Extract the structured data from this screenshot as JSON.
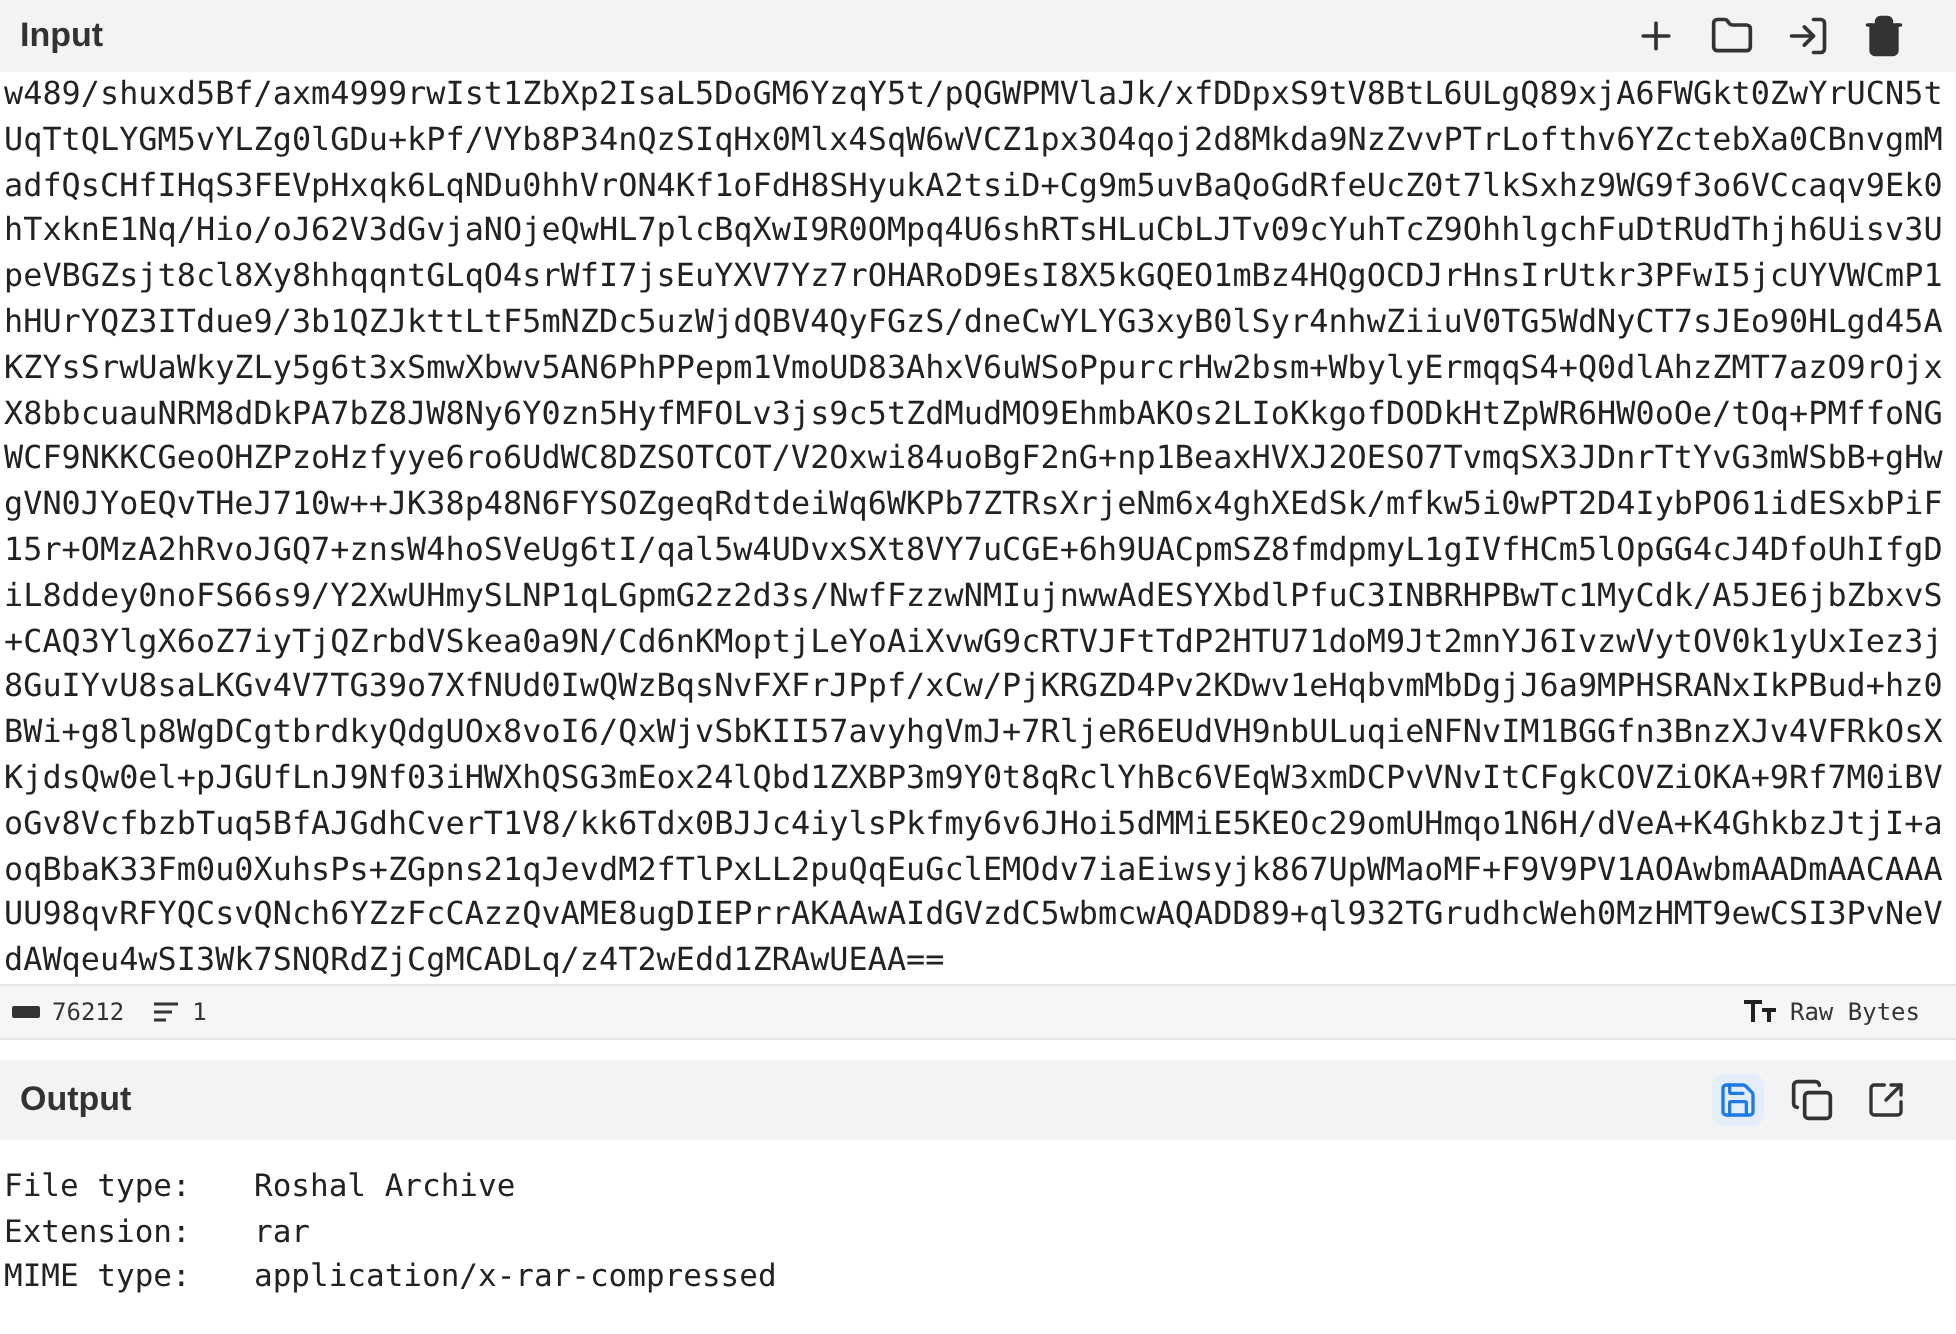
{
  "input": {
    "title": "Input",
    "lines": [
      "w489/shuxd5Bf/axm4999rwIst1ZbXp2IsaL5DoGM6YzqY5t/pQGWPMVlaJk/xfDDpxS9tV8BtL6ULgQ89xjA6FWGkt0ZwYrUCN5t",
      "UqTtQLYGM5vYLZg0lGDu+kPf/VYb8P34nQzSIqHx0Mlx4SqW6wVCZ1px3O4qoj2d8Mkda9NzZvvPTrLofthv6YZctebXa0CBnvgmM",
      "adfQsCHfIHqS3FEVpHxqk6LqNDu0hhVrON4Kf1oFdH8SHyukA2tsiD+Cg9m5uvBaQoGdRfeUcZ0t7lkSxhz9WG9f3o6VCcaqv9Ek0",
      "hTxknE1Nq/Hio/oJ62V3dGvjaNOjeQwHL7plcBqXwI9R0OMpq4U6shRTsHLuCbLJTv09cYuhTcZ9OhhlgchFuDtRUdThjh6Uisv3U",
      "peVBGZsjt8cl8Xy8hhqqntGLqO4srWfI7jsEuYXV7Yz7rOHARoD9EsI8X5kGQEO1mBz4HQgOCDJrHnsIrUtkr3PFwI5jcUYVWCmP1",
      "hHUrYQZ3ITdue9/3b1QZJkttLtF5mNZDc5uzWjdQBV4QyFGzS/dneCwYLYG3xyB0lSyr4nhwZiiuV0TG5WdNyCT7sJEo90HLgd45A",
      "KZYsSrwUaWkyZLy5g6t3xSmwXbwv5AN6PhPPepm1VmoUD83AhxV6uWSoPpurcrHw2bsm+WbylyErmqqS4+Q0dlAhzZMT7azO9rOjx",
      "X8bbcuauNRM8dDkPA7bZ8JW8Ny6Y0zn5HyfMFOLv3js9c5tZdMudMO9EhmbAKOs2LIoKkgofDODkHtZpWR6HW0oOe/tOq+PMffoNG",
      "WCF9NKKCGeoOHZPzoHzfyye6ro6UdWC8DZSOTCOT/V2Oxwi84uoBgF2nG+np1BeaxHVXJ2OESO7TvmqSX3JDnrTtYvG3mWSbB+gHw",
      "gVN0JYoEQvTHeJ710w++JK38p48N6FYSOZgeqRdtdeiWq6WKPb7ZTRsXrjeNm6x4ghXEdSk/mfkw5i0wPT2D4IybPO61idESxbPiF",
      "15r+OMzA2hRvoJGQ7+znsW4hoSVeUg6tI/qal5w4UDvxSXt8VY7uCGE+6h9UACpmSZ8fmdpmyL1gIVfHCm5lOpGG4cJ4DfoUhIfgD",
      "iL8ddey0noFS66s9/Y2XwUHmySLNP1qLGpmG2z2d3s/NwfFzzwNMIujnwwAdESYXbdlPfuC3INBRHPBwTc1MyCdk/A5JE6jbZbxvS",
      "+CAQ3YlgX6oZ7iyTjQZrbdVSkea0a9N/Cd6nKMoptjLeYoAiXvwG9cRTVJFtTdP2HTU71doM9Jt2mnYJ6IvzwVytOV0k1yUxIez3j",
      "8GuIYvU8saLKGv4V7TG39o7XfNUd0IwQWzBqsNvFXFrJPpf/xCw/PjKRGZD4Pv2KDwv1eHqbvmMbDgjJ6a9MPHSRANxIkPBud+hz0",
      "BWi+g8lp8WgDCgtbrdkyQdgUOx8voI6/QxWjvSbKII57avyhgVmJ+7RljeR6EUdVH9nbULuqieNFNvIM1BGGfn3BnzXJv4VFRkOsX",
      "KjdsQw0el+pJGUfLnJ9Nf03iHWXhQSG3mEox24lQbd1ZXBP3m9Y0t8qRclYhBc6VEqW3xmDCPvVNvItCFgkCOVZiOKA+9Rf7M0iBV",
      "oGv8VcfbzbTuq5BfAJGdhCverT1V8/kk6Tdx0BJJc4iylsPkfmy6v6JHoi5dMMiE5KEOc29omUHmqo1N6H/dVeA+K4GhkbzJtjI+a",
      "oqBbaK33Fm0u0XuhsPs+ZGpns21qJevdM2fTlPxLL2puQqEuGclEMOdv7iaEiwsyjk867UpWMaoMF+F9V9PV1AOAwbmAADmAACAAA",
      "UU98qvRFYQCsvQNch6YZzFcCAzzQvAME8ugDIEPrrAKAAwAIdGVzdC5wbmcwAQADD89+ql932TGrudhcWeh0MzHMT9ewCSI3PvNeV",
      "dAWqeu4wSI3Wk7SNQRdZjCgMCADLq/z4T2wEdd1ZRAwUEAA=="
    ]
  },
  "status": {
    "length": "76212",
    "lines": "1",
    "encoding": "Raw Bytes"
  },
  "output": {
    "title": "Output",
    "rows": [
      {
        "label": "File type:",
        "value": "Roshal Archive"
      },
      {
        "label": "Extension:",
        "value": "rar"
      },
      {
        "label": "MIME type:",
        "value": "application/x-rar-compressed"
      }
    ]
  }
}
